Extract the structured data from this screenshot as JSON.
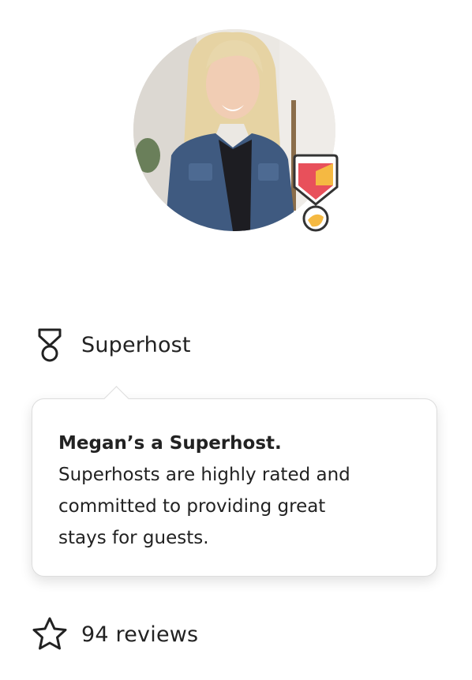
{
  "host": {
    "avatar": "host-photo",
    "badge_icon": "superhost-badge-icon"
  },
  "superhost": {
    "label": "Superhost",
    "icon": "medal-icon"
  },
  "tooltip": {
    "title": "Megan’s a Superhost.",
    "body": "Superhosts are highly rated and committed to providing great stays for guests."
  },
  "reviews": {
    "label": "94 reviews",
    "icon": "star-outline-icon"
  },
  "colors": {
    "text": "#222222",
    "badge_red": "#e8505b",
    "badge_yellow": "#f5b942",
    "border": "#dddddd"
  }
}
